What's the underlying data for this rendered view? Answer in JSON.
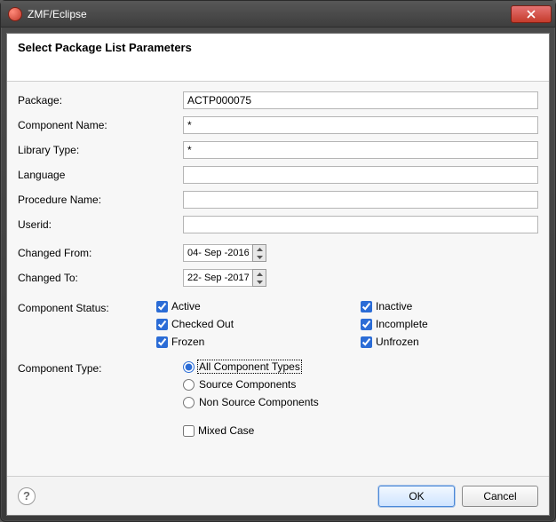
{
  "window": {
    "title": "ZMF/Eclipse"
  },
  "banner": {
    "heading": "Select Package List Parameters"
  },
  "labels": {
    "package": "Package:",
    "componentName": "Component Name:",
    "libraryType": "Library Type:",
    "language": "Language",
    "procedureName": "Procedure Name:",
    "userid": "Userid:",
    "changedFrom": "Changed From:",
    "changedTo": "Changed  To:",
    "componentStatus": "Component Status:",
    "componentType": "Component Type:"
  },
  "fields": {
    "package": "ACTP000075",
    "componentName": "*",
    "libraryType": "*",
    "language": "",
    "procedureName": "",
    "userid": "",
    "changedFrom": "04- Sep -2016",
    "changedTo": "22- Sep -2017"
  },
  "status": {
    "active": {
      "label": "Active",
      "checked": true
    },
    "checkedOut": {
      "label": "Checked Out",
      "checked": true
    },
    "frozen": {
      "label": "Frozen",
      "checked": true
    },
    "inactive": {
      "label": "Inactive",
      "checked": true
    },
    "incomplete": {
      "label": "Incomplete",
      "checked": true
    },
    "unfrozen": {
      "label": "Unfrozen",
      "checked": true
    }
  },
  "type": {
    "selected": "all",
    "all": {
      "label": "All Component Types"
    },
    "source": {
      "label": "Source Components"
    },
    "non": {
      "label": "Non Source Components"
    }
  },
  "mixedCase": {
    "label": "Mixed Case",
    "checked": false
  },
  "buttons": {
    "ok": "OK",
    "cancel": "Cancel",
    "help": "?"
  }
}
